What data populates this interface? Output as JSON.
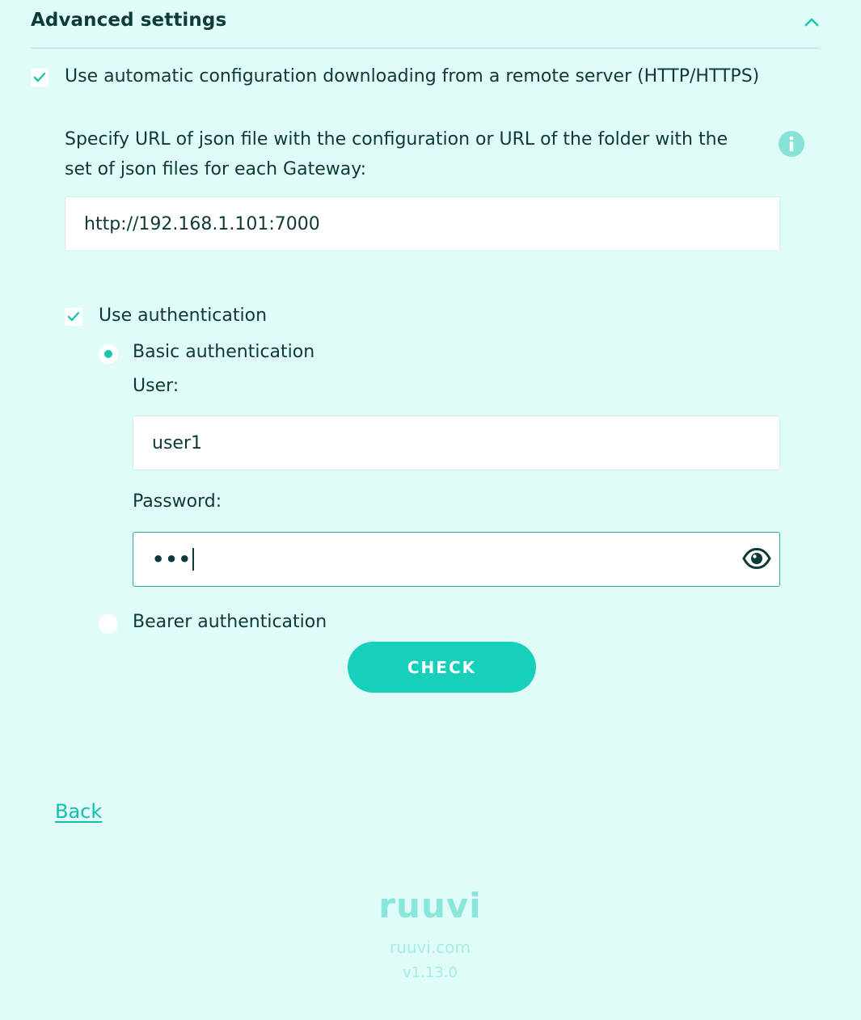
{
  "section": {
    "title": "Advanced settings"
  },
  "auto_config": {
    "checked": true,
    "label": "Use automatic configuration downloading from a remote server (HTTP/HTTPS)",
    "description": "Specify URL of json file with the configuration or URL of the folder with the set of json files for each Gateway:",
    "url_value": "http://192.168.1.101:7000"
  },
  "auth": {
    "use_label": "Use authentication",
    "checked": true,
    "basic": {
      "label": "Basic authentication",
      "selected": true,
      "user_label": "User:",
      "user_value": "user1",
      "password_label": "Password:",
      "password_mask": "•••"
    },
    "bearer": {
      "label": "Bearer authentication",
      "selected": false
    }
  },
  "actions": {
    "check_label": "CHECK",
    "back_label": "Back"
  },
  "footer": {
    "logo_text": "ruuvi",
    "site_link": "ruuvi.com",
    "version": "v1.13.0"
  },
  "colors": {
    "background": "#e0fcf8",
    "accent": "#16d0bb",
    "text": "#0d3a38"
  },
  "icons": {
    "collapse": "chevron-up-icon",
    "info": "info-icon",
    "eye": "eye-icon",
    "check": "checkmark-icon"
  }
}
